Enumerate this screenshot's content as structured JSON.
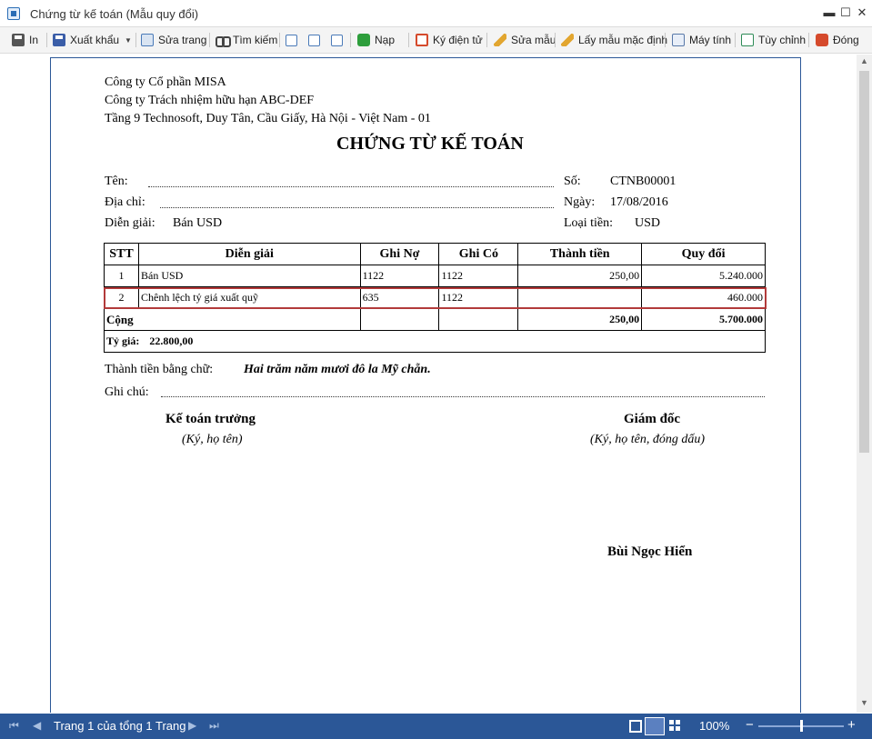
{
  "window": {
    "title": "Chứng từ kế toán (Mẫu quy đổi)",
    "minimize": "▬",
    "maximize": "☐",
    "close": "✕"
  },
  "toolbar": {
    "print": "In",
    "export": "Xuất khẩu",
    "edit_page": "Sửa trang",
    "find": "Tìm kiếm",
    "reload": "Nạp",
    "e_sign": "Ký điện tử",
    "edit_template": "Sửa mẫu",
    "default_template": "Lấy mẫu mặc định",
    "calculator": "Máy tính",
    "customize": "Tùy chỉnh",
    "close": "Đóng"
  },
  "document": {
    "company_line1": "Công ty Cổ phần MISA",
    "company_line2": "Công ty Trách nhiệm hữu hạn ABC-DEF",
    "company_line3": "Tầng 9 Technosoft, Duy Tân, Cầu Giấy, Hà Nội - Việt Nam - 01",
    "title": "CHỨNG TỪ KẾ TOÁN",
    "name_label": "Tên:",
    "address_label": "Địa chỉ:",
    "desc_label": "Diễn giải:",
    "desc_value": "Bán USD",
    "number_label": "Số:",
    "number_value": "CTNB00001",
    "date_label": "Ngày:",
    "date_value": "17/08/2016",
    "currency_label": "Loại tiền:",
    "currency_value": "USD",
    "table": {
      "headers": [
        "STT",
        "Diễn giải",
        "Ghi Nợ",
        "Ghi Có",
        "Thành tiền",
        "Quy đổi"
      ],
      "rows": [
        {
          "stt": "1",
          "desc": "Bán USD",
          "debit": "1122",
          "credit": "1122",
          "amount": "250,00",
          "converted": "5.240.000"
        },
        {
          "stt": "2",
          "desc": "Chênh lệch tỷ giá xuất quỹ",
          "debit": "635",
          "credit": "1122",
          "amount": "",
          "converted": "460.000"
        }
      ],
      "total_label": "Cộng",
      "total_amount": "250,00",
      "total_converted": "5.700.000",
      "rate_label": "Tỷ giá:",
      "rate_value": "22.800,00"
    },
    "amount_words_label": "Thành tiền bằng chữ:",
    "amount_words_value": "Hai trăm năm mươi đô la Mỹ chẵn.",
    "note_label": "Ghi chú:",
    "chief_accountant": "Kế toán trưởng",
    "chief_accountant_sub": "(Ký, họ tên)",
    "director": "Giám đốc",
    "director_sub": "(Ký, họ tên, đóng dấu)",
    "director_name": "Bùi Ngọc Hiển"
  },
  "statusbar": {
    "page_info": "Trang 1 của tổng 1 Trang",
    "zoom": "100%",
    "first": "⏮",
    "prev": "◀",
    "next": "▶",
    "last": "⏭",
    "zoom_out": "−",
    "zoom_in": "+"
  }
}
